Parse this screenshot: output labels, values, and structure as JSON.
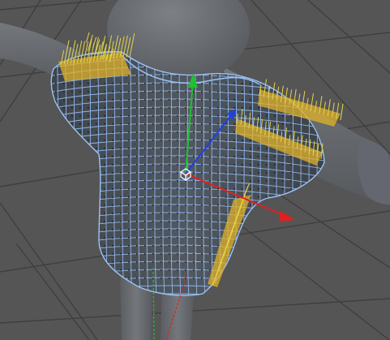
{
  "viewport": {
    "kind": "3d-perspective-viewport",
    "background_color": "#555556",
    "grid_color": "#3a3a3b"
  },
  "scene": {
    "objects": [
      {
        "name": "mannequin",
        "color": "#6b6e72",
        "selected": false
      },
      {
        "name": "shirt-cloth-mesh",
        "color": "#4a4f55",
        "wire_color": "#8fb6ea",
        "selected": true
      }
    ],
    "highlight_color": "#e0b12a",
    "vertex_guide_color": "#e5d545"
  },
  "gizmo": {
    "axes": [
      {
        "axis": "x",
        "color": "#e02020"
      },
      {
        "axis": "y",
        "color": "#20c030"
      },
      {
        "axis": "z",
        "color": "#2040e0"
      }
    ]
  }
}
